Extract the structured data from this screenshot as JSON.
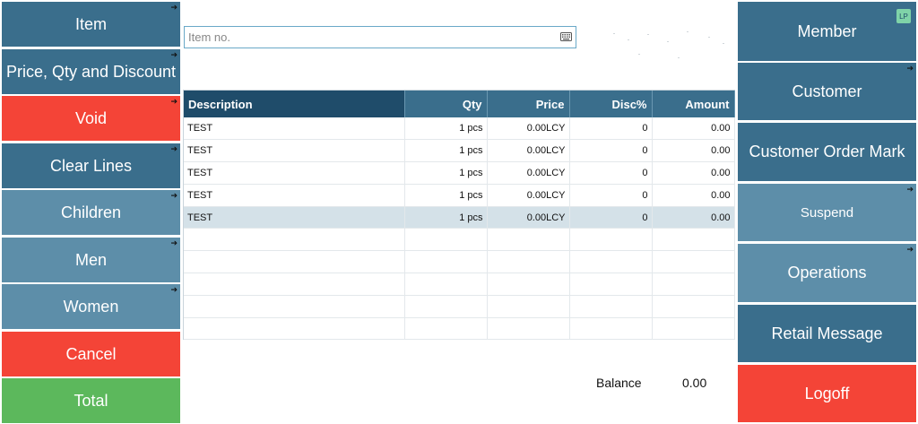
{
  "left_buttons": [
    {
      "label": "Item",
      "style": "dark",
      "arrow": true
    },
    {
      "label": "Price, Qty and Discount",
      "style": "dark",
      "arrow": true
    },
    {
      "label": "Void",
      "style": "red",
      "arrow": true
    },
    {
      "label": "Clear Lines",
      "style": "dark",
      "arrow": true
    },
    {
      "label": "Children",
      "style": "mid",
      "arrow": true
    },
    {
      "label": "Men",
      "style": "mid",
      "arrow": true
    },
    {
      "label": "Women",
      "style": "mid",
      "arrow": true
    },
    {
      "label": "Cancel",
      "style": "red",
      "arrow": false
    },
    {
      "label": "Total",
      "style": "green",
      "arrow": false
    }
  ],
  "search": {
    "placeholder": "Item no.",
    "value": "",
    "icon": "keyboard-icon"
  },
  "grid": {
    "columns": [
      "Description",
      "Qty",
      "Price",
      "Disc%",
      "Amount"
    ],
    "rows": [
      [
        "TEST",
        "1 pcs",
        "0.00LCY",
        "0",
        "0.00"
      ],
      [
        "TEST",
        "1 pcs",
        "0.00LCY",
        "0",
        "0.00"
      ],
      [
        "TEST",
        "1 pcs",
        "0.00LCY",
        "0",
        "0.00"
      ],
      [
        "TEST",
        "1 pcs",
        "0.00LCY",
        "0",
        "0.00"
      ],
      [
        "TEST",
        "1 pcs",
        "0.00LCY",
        "0",
        "0.00"
      ]
    ],
    "selected_row": 4,
    "empty_rows": 5
  },
  "balance": {
    "label": "Balance",
    "value": "0.00"
  },
  "right_buttons": [
    {
      "label": "Member",
      "style": "dark",
      "arrow": false,
      "badge": "LP"
    },
    {
      "label": "Customer",
      "style": "dark",
      "arrow": true
    },
    {
      "label": "Customer Order Mark",
      "style": "dark",
      "arrow": false
    },
    {
      "label": "Suspend",
      "style": "mid",
      "arrow": true
    },
    {
      "label": "Operations",
      "style": "mid",
      "arrow": true
    },
    {
      "label": "Retail Message",
      "style": "dark",
      "arrow": false
    },
    {
      "label": "Logoff",
      "style": "red",
      "arrow": false
    }
  ],
  "colors": {
    "dark": "#3a6e8c",
    "mid": "#5d8ea9",
    "red": "#f44437",
    "green": "#5cb85c",
    "header_first": "#1f4c6a",
    "selected_row": "#d4e1e8"
  }
}
